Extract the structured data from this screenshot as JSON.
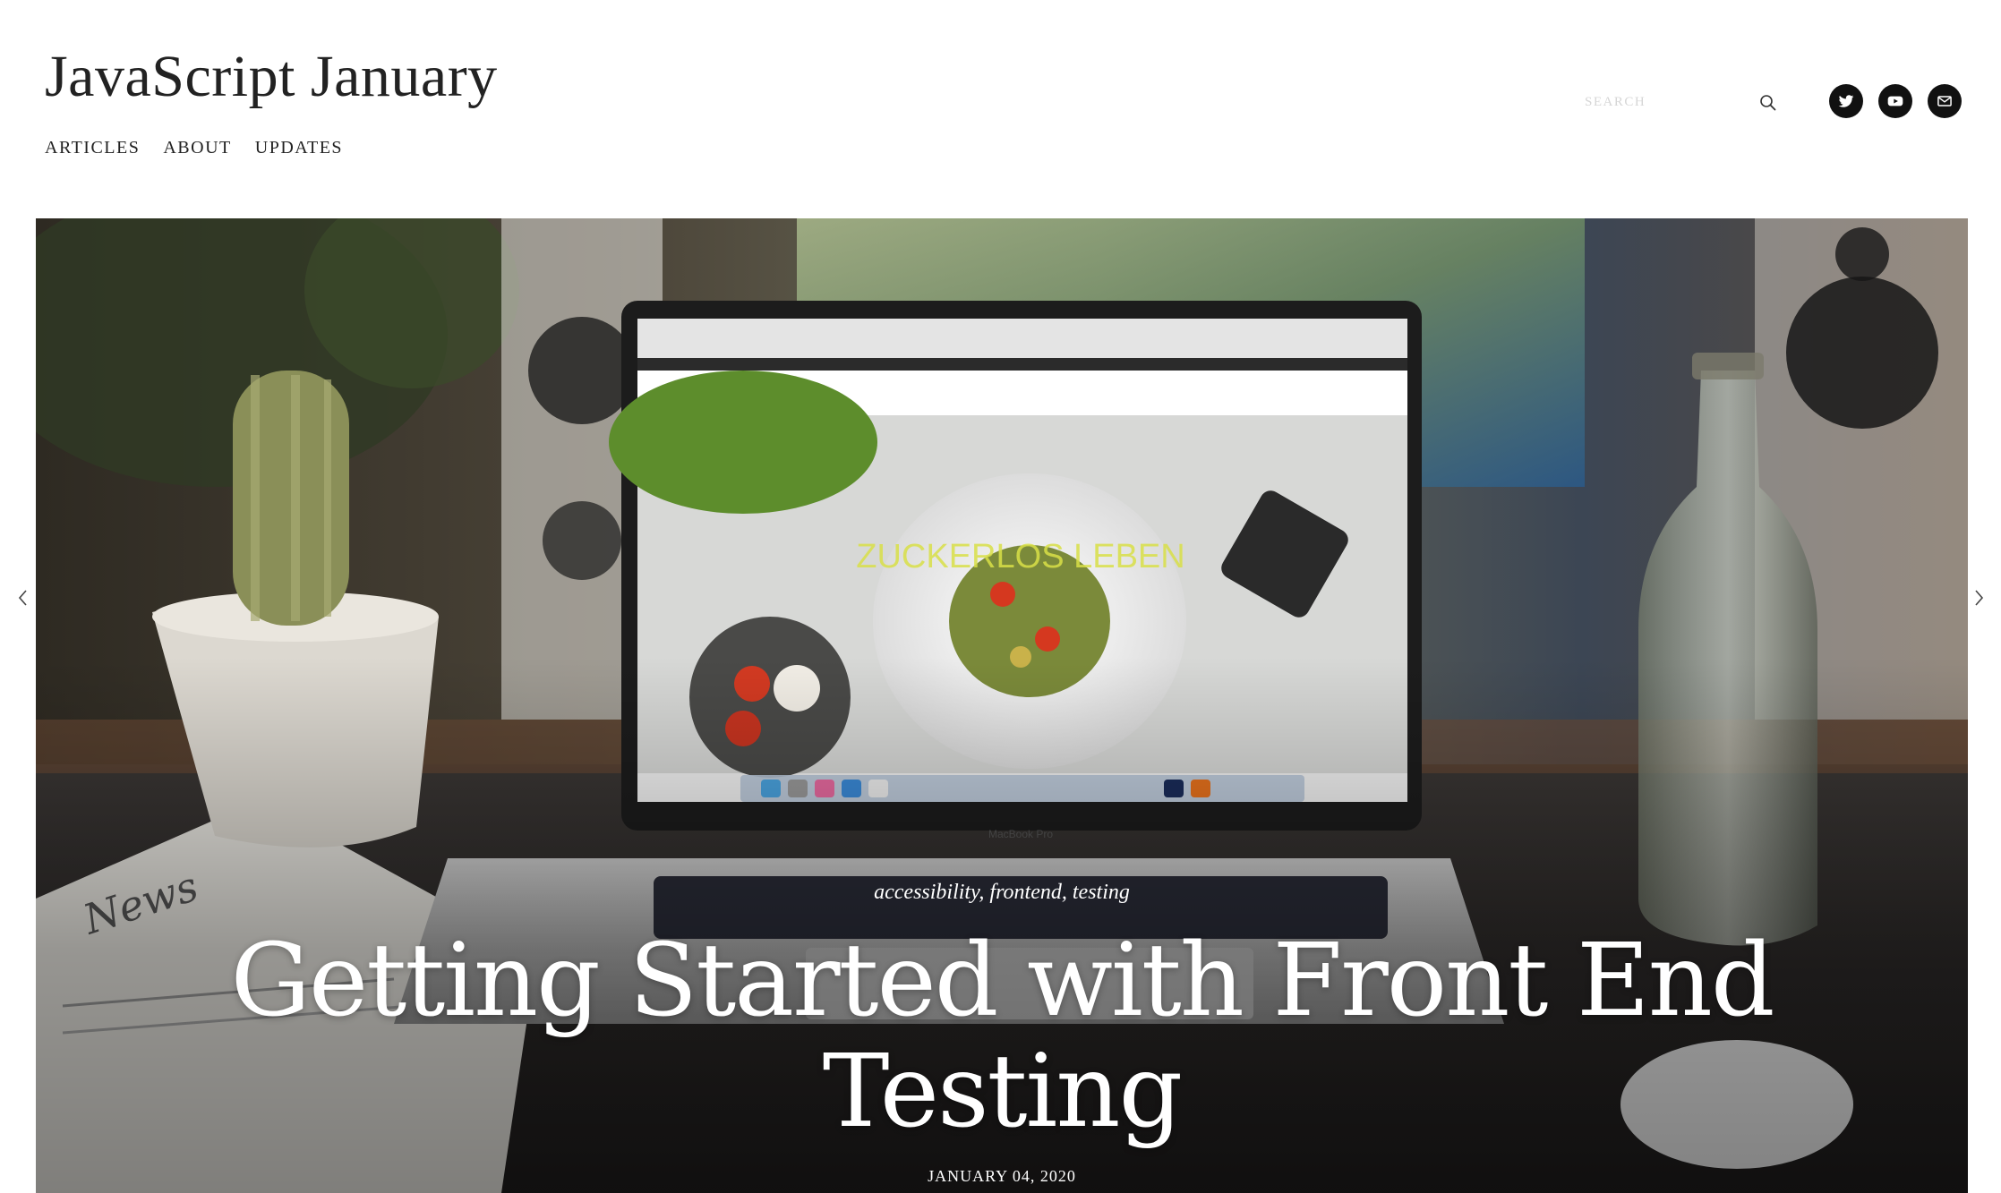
{
  "site": {
    "title": "JavaScript January"
  },
  "nav": {
    "items": [
      {
        "label": "ARTICLES"
      },
      {
        "label": "ABOUT"
      },
      {
        "label": "UPDATES"
      }
    ]
  },
  "search": {
    "placeholder": "SEARCH",
    "value": "",
    "icon": "search-icon"
  },
  "social": {
    "items": [
      {
        "name": "twitter",
        "icon": "twitter-icon"
      },
      {
        "name": "youtube",
        "icon": "youtube-icon"
      },
      {
        "name": "email",
        "icon": "mail-icon"
      }
    ],
    "color": "#111111"
  },
  "hero": {
    "tags": [
      "accessibility",
      "frontend",
      "testing"
    ],
    "tags_text": "accessibility, frontend, testing",
    "title": "Getting Started with Front End Testing",
    "date": "JANUARY 04, 2020",
    "image_alt": "Laptop on a desk with a cactus, newspaper, glass bottle and mouse",
    "laptop_label": "MacBook Pro",
    "screen_heading": "ZUCKERLOS LEBEN",
    "prev_icon": "chevron-left-icon",
    "next_icon": "chevron-right-icon"
  }
}
